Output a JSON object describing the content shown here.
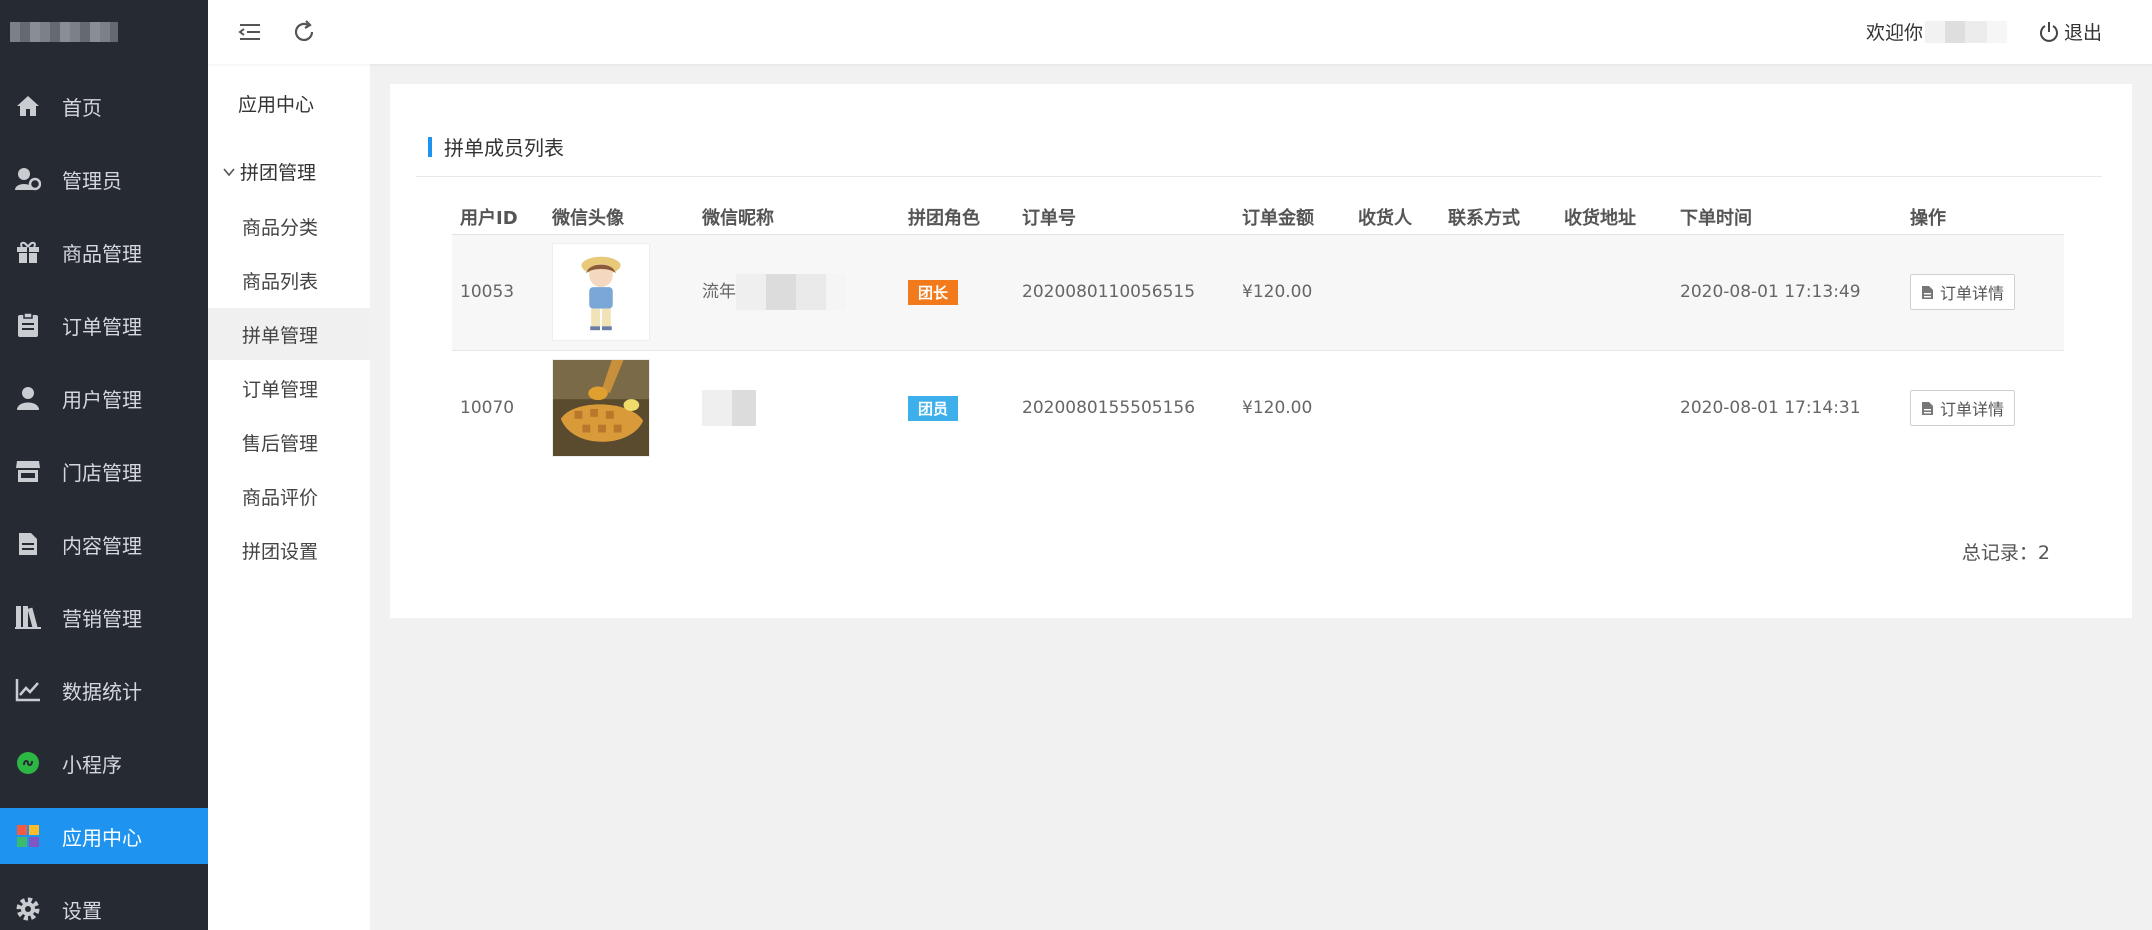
{
  "sidebar": {
    "items": [
      {
        "label": "首页",
        "icon": "home-icon"
      },
      {
        "label": "管理员",
        "icon": "admin-user-icon"
      },
      {
        "label": "商品管理",
        "icon": "gift-icon"
      },
      {
        "label": "订单管理",
        "icon": "clipboard-icon"
      },
      {
        "label": "用户管理",
        "icon": "user-icon"
      },
      {
        "label": "门店管理",
        "icon": "store-icon"
      },
      {
        "label": "内容管理",
        "icon": "document-icon"
      },
      {
        "label": "营销管理",
        "icon": "books-icon"
      },
      {
        "label": "数据统计",
        "icon": "line-chart-icon"
      },
      {
        "label": "小程序",
        "icon": "mini-program-icon"
      },
      {
        "label": "应用中心",
        "icon": "apps-icon",
        "active": true
      },
      {
        "label": "设置",
        "icon": "gear-icon"
      }
    ],
    "active_color": "#1e94f0",
    "bg_color": "#262b33"
  },
  "subnav": {
    "title": "应用中心",
    "group": "拼团管理",
    "items": [
      {
        "label": "商品分类"
      },
      {
        "label": "商品列表"
      },
      {
        "label": "拼单管理",
        "active": true
      },
      {
        "label": "订单管理"
      },
      {
        "label": "售后管理"
      },
      {
        "label": "商品评价"
      },
      {
        "label": "拼团设置"
      }
    ]
  },
  "header": {
    "welcome": "欢迎你",
    "logout": "退出"
  },
  "card": {
    "title": "拼单成员列表",
    "columns": [
      "用户ID",
      "微信头像",
      "微信昵称",
      "拼团角色",
      "订单号",
      "订单金额",
      "收货人",
      "联系方式",
      "收货地址",
      "下单时间",
      "操作"
    ],
    "rows": [
      {
        "user_id": "10053",
        "nickname": "流年",
        "role": "团长",
        "order_no": "2020080110056515",
        "amount": "¥120.00",
        "receiver": "",
        "contact": "",
        "address": "",
        "time": "2020-08-01 17:13:49",
        "action": "订单详情"
      },
      {
        "user_id": "10070",
        "nickname": "",
        "role": "团员",
        "order_no": "2020080155505156",
        "amount": "¥120.00",
        "receiver": "",
        "contact": "",
        "address": "",
        "time": "2020-08-01 17:14:31",
        "action": "订单详情"
      }
    ],
    "total": "总记录：2"
  }
}
